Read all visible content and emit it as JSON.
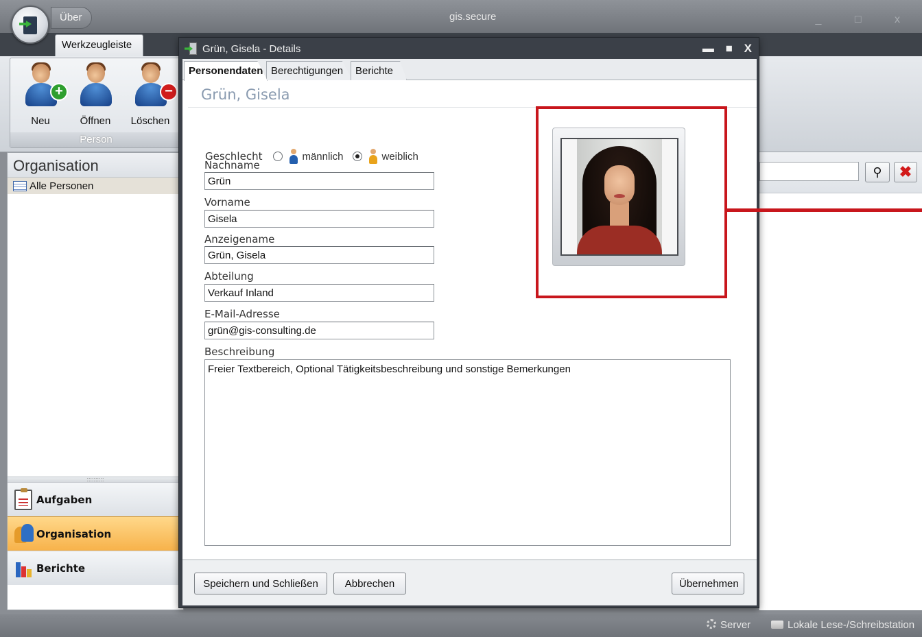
{
  "app": {
    "title": "gis.secure",
    "about_tab": "Über",
    "window_controls": "_ □ x"
  },
  "ribbon": {
    "tab": "Werkzeugleiste",
    "group": "Person",
    "buttons": [
      {
        "label": "Neu",
        "icon": "person-add-icon"
      },
      {
        "label": "Öffnen",
        "icon": "person-open-icon"
      },
      {
        "label": "Löschen",
        "icon": "person-delete-icon"
      }
    ]
  },
  "nav": {
    "header": "Organisation",
    "items": [
      {
        "label": "Alle Personen",
        "icon": "list-icon"
      }
    ],
    "splitter": "::::::::::",
    "buttons": [
      {
        "label": "Aufgaben",
        "icon": "clipboard-icon",
        "active": false
      },
      {
        "label": "Organisation",
        "icon": "people-icon",
        "active": true
      },
      {
        "label": "Berichte",
        "icon": "chart-icon",
        "active": false
      }
    ]
  },
  "search": {
    "value": "",
    "search_icon": "⚲",
    "clear_icon": "✖"
  },
  "statusbar": {
    "server": "Server",
    "local": "Lokale Lese-/Schreibstation"
  },
  "dialog": {
    "title": "Grün, Gisela - Details",
    "controls": {
      "minimize": "▬",
      "maximize": "■",
      "close": "X"
    },
    "tabs": [
      "Personendaten",
      "Berechtigungen",
      "Berichte"
    ],
    "active_tab": "Personendaten",
    "person_name": "Grün, Gisela",
    "gender": {
      "label": "Geschlecht",
      "options": [
        "männlich",
        "weiblich"
      ],
      "selected": "weiblich"
    },
    "fields": {
      "nachname": {
        "label": "Nachname",
        "value": "Grün"
      },
      "vorname": {
        "label": "Vorname",
        "value": "Gisela"
      },
      "anzeigename": {
        "label": "Anzeigename",
        "value": "Grün, Gisela"
      },
      "abteilung": {
        "label": "Abteilung",
        "value": "Verkauf Inland"
      },
      "email": {
        "label": "E-Mail-Adresse",
        "value": "grün@gis-consulting.de"
      },
      "beschreibung": {
        "label": "Beschreibung",
        "value": "Freier Textbereich, Optional Tätigkeitsbeschreibung und sonstige Bemerkungen"
      }
    },
    "footer": {
      "save_close": "Speichern und Schließen",
      "cancel": "Abbrechen",
      "apply": "Übernehmen"
    }
  },
  "colors": {
    "highlight": "#c8161c",
    "nav_active": "#f7b24a",
    "dialog_frame": "#3b4048"
  }
}
